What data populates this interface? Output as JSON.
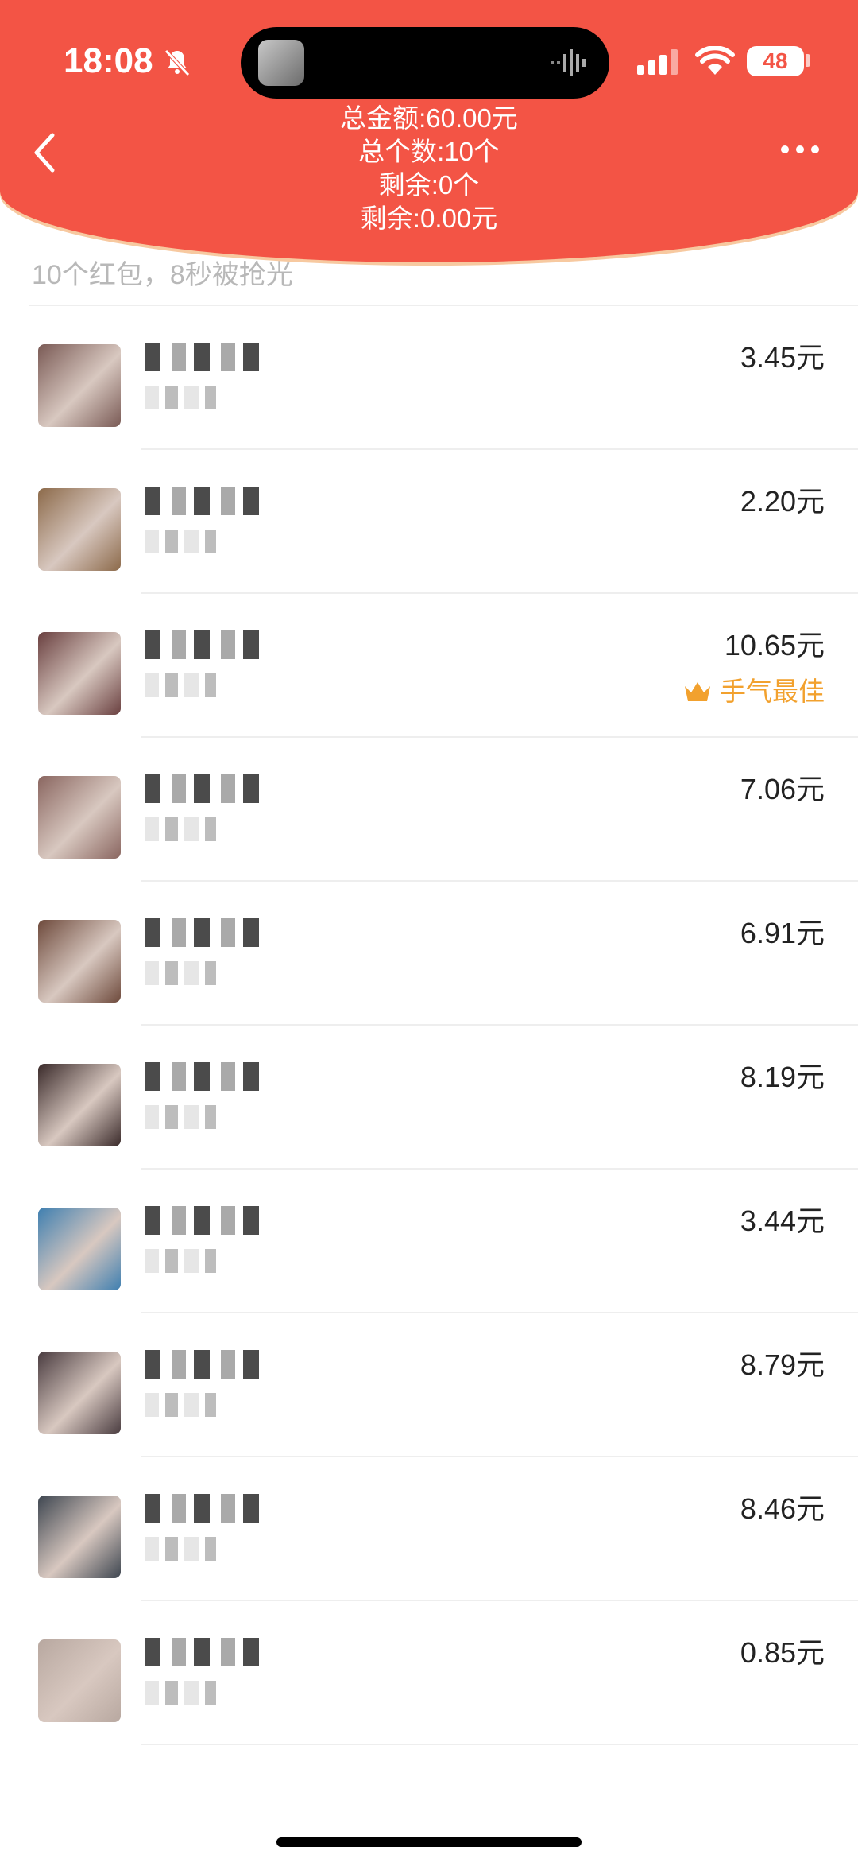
{
  "status_bar": {
    "time": "18:08",
    "battery": "48",
    "icons": [
      "bell-muted-icon",
      "signal-icon",
      "wifi-icon",
      "battery-icon"
    ]
  },
  "header": {
    "back_icon": "back-arrow-icon",
    "more_icon": "more-icon",
    "summary": {
      "total_amount": "总金额:60.00元",
      "total_count": "总个数:10个",
      "remaining_count": "剩余:0个",
      "remaining_amount": "剩余:0.00元"
    }
  },
  "list_info": "10个红包，8秒被抢光",
  "records": [
    {
      "amount": "3.45元",
      "avatar_color": "#7a5a55"
    },
    {
      "amount": "2.20元",
      "avatar_color": "#8c6a4a"
    },
    {
      "amount": "10.65元",
      "best_label": "手气最佳",
      "avatar_color": "#6a4040"
    },
    {
      "amount": "7.06元",
      "avatar_color": "#8a6660"
    },
    {
      "amount": "6.91元",
      "avatar_color": "#6e4a3c"
    },
    {
      "amount": "8.19元",
      "avatar_color": "#3a2a2a"
    },
    {
      "amount": "3.44元",
      "avatar_color": "#3f7fb0"
    },
    {
      "amount": "8.79元",
      "avatar_color": "#4a3c40"
    },
    {
      "amount": "8.46元",
      "avatar_color": "#3e4650"
    },
    {
      "amount": "0.85元",
      "avatar_color": "#b8a8a0"
    }
  ],
  "colors": {
    "header_bg": "#f35445",
    "best_label": "#f2a12e"
  }
}
